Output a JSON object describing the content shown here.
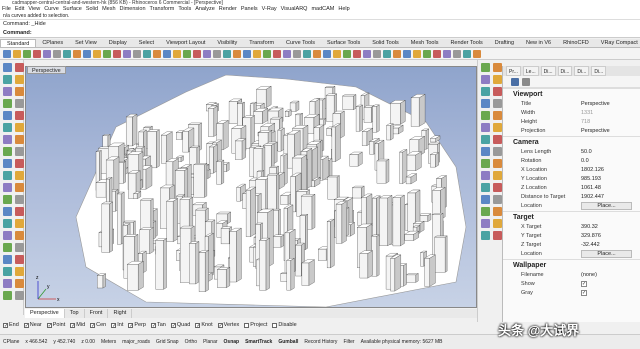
{
  "window": {
    "title": "cadmapper-central-central-and-western-hk (856 KB) - Rhinoceros 6 Commercial - [Perspective]"
  },
  "menu": [
    "File",
    "Edit",
    "View",
    "Curve",
    "Surface",
    "Solid",
    "Mesh",
    "Dimension",
    "Transform",
    "Tools",
    "Analyze",
    "Render",
    "Panels",
    "V-Ray",
    "VisualARQ",
    "madCAM",
    "Help"
  ],
  "command": {
    "history": "n/a curves added to selection.",
    "line1": "Command: _Hide",
    "prompt": "Command:"
  },
  "toolbar_tabs": [
    "Standard",
    "CPlanes",
    "Set View",
    "Display",
    "Select",
    "Viewport Layout",
    "Visibility",
    "Transform",
    "Curve Tools",
    "Surface Tools",
    "Solid Tools",
    "Mesh Tools",
    "Render Tools",
    "Drafting",
    "New in V6",
    "RhinoCFD",
    "VRay Compact"
  ],
  "viewport": {
    "label": "Perspective",
    "axis_x": "x",
    "axis_y": "y",
    "axis_z": "z"
  },
  "view_tabs": [
    "Perspective",
    "Top",
    "Front",
    "Right"
  ],
  "osnaps": [
    {
      "label": "End",
      "checked": true
    },
    {
      "label": "Near",
      "checked": true
    },
    {
      "label": "Point",
      "checked": true
    },
    {
      "label": "Mid",
      "checked": true
    },
    {
      "label": "Cen",
      "checked": true
    },
    {
      "label": "Int",
      "checked": true
    },
    {
      "label": "Perp",
      "checked": true
    },
    {
      "label": "Tan",
      "checked": true
    },
    {
      "label": "Quad",
      "checked": true
    },
    {
      "label": "Knot",
      "checked": true
    },
    {
      "label": "Vertex",
      "checked": true
    },
    {
      "label": "Project",
      "checked": false
    },
    {
      "label": "Disable",
      "checked": false
    }
  ],
  "status": {
    "cplane": "CPlane",
    "x": "x 466.542",
    "y": "y 452.740",
    "z": "z 0.00",
    "units": "Meters",
    "layer": "major_roads",
    "grid_snap": "Grid Snap",
    "ortho": "Ortho",
    "planar": "Planar",
    "osnap": "Osnap",
    "smarttrack": "SmartTrack",
    "gumball": "Gumball",
    "record_history": "Record History",
    "filter": "Filter",
    "memory": "Available physical memory: 5627 MB"
  },
  "panel": {
    "tabs": [
      "Pr...",
      "Le...",
      "Di...",
      "Di...",
      "Di...",
      "Di..."
    ],
    "viewport_section": "Viewport",
    "viewport_rows": [
      {
        "k": "Title",
        "v": "Perspective",
        "dim": false
      },
      {
        "k": "Width",
        "v": "1331",
        "dim": true
      },
      {
        "k": "Height",
        "v": "718",
        "dim": true
      },
      {
        "k": "Projection",
        "v": "Perspective",
        "dim": false
      }
    ],
    "camera_section": "Camera",
    "camera_rows": [
      {
        "k": "Lens Length",
        "v": "50.0"
      },
      {
        "k": "Rotation",
        "v": "0.0"
      },
      {
        "k": "X Location",
        "v": "1802.126"
      },
      {
        "k": "Y Location",
        "v": "985.193"
      },
      {
        "k": "Z Location",
        "v": "1061.48"
      },
      {
        "k": "Distance to Target",
        "v": "1902.447"
      }
    ],
    "camera_location_label": "Location",
    "camera_place_button": "Place...",
    "target_section": "Target",
    "target_rows": [
      {
        "k": "X Target",
        "v": "390.32"
      },
      {
        "k": "Y Target",
        "v": "329.876"
      },
      {
        "k": "Z Target",
        "v": "-32.442"
      }
    ],
    "target_location_label": "Location",
    "target_place_button": "Place...",
    "wallpaper_section": "Wallpaper",
    "wallpaper_filename_label": "Filename",
    "wallpaper_filename_value": "(none)",
    "wallpaper_show_label": "Show",
    "wallpaper_gray_label": "Gray"
  },
  "watermark": "头条 @大试界",
  "colors": {
    "sky_top": "#8fa4cc",
    "sky_bottom": "#c7d2e6",
    "terrain": "#ffffff"
  }
}
